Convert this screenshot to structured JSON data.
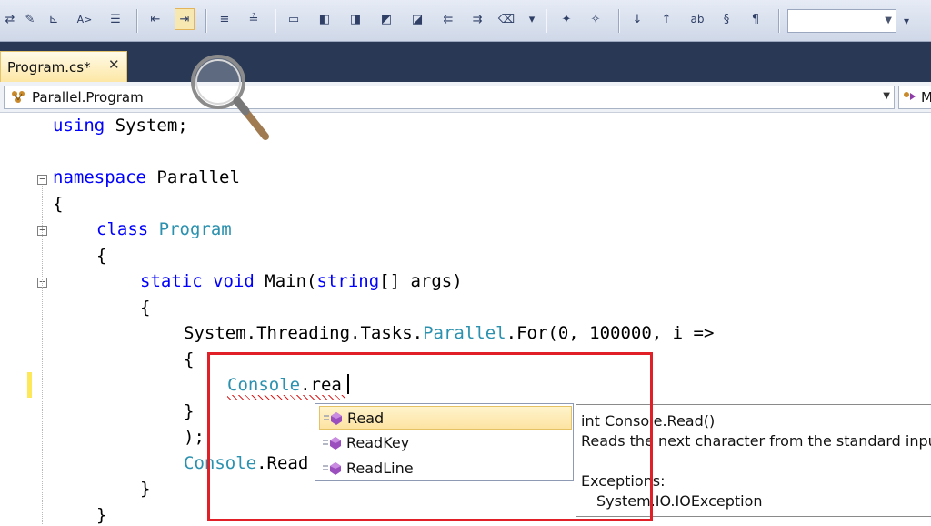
{
  "window": {
    "tab": {
      "label": "Program.cs*",
      "close_glyph": "✕"
    }
  },
  "toolbar": {
    "buttons": [
      {
        "icon": "refactor-icon"
      },
      {
        "icon": "rename-icon"
      },
      {
        "icon": "font-icon",
        "text": "A>"
      },
      {
        "icon": "outline-icon"
      },
      {
        "icon": "decrease-indent-icon"
      },
      {
        "icon": "increase-indent-icon"
      },
      {
        "icon": "comment-icon"
      },
      {
        "icon": "uncomment-icon"
      },
      {
        "icon": "bookmark-icon"
      },
      {
        "icon": "prev-bookmark-icon"
      },
      {
        "icon": "next-bookmark-icon"
      },
      {
        "icon": "prev-folder-bookmark-icon"
      },
      {
        "icon": "next-folder-bookmark-icon"
      },
      {
        "icon": "prev-doc-bookmark-icon"
      },
      {
        "icon": "next-doc-bookmark-icon"
      },
      {
        "icon": "clear-bookmarks-icon"
      },
      {
        "icon": "new-item-icon"
      },
      {
        "icon": "add-item-icon"
      },
      {
        "icon": "move-down-icon"
      },
      {
        "icon": "move-up-icon"
      },
      {
        "icon": "replace-icon",
        "text": "ab"
      },
      {
        "icon": "format-icon"
      },
      {
        "icon": "format-doc-icon"
      }
    ]
  },
  "navbar": {
    "type_combo": "Parallel.Program",
    "member_combo": "M"
  },
  "code": {
    "l1": [
      "using",
      " System;"
    ],
    "l2": [
      "namespace",
      " Parallel"
    ],
    "l3": "{",
    "l4": [
      "class",
      " ",
      "Program"
    ],
    "l5": "{",
    "l6": [
      "static",
      " ",
      "void",
      " Main(",
      "string",
      "[] args)"
    ],
    "l7": "{",
    "l8": [
      "System.Threading.Tasks.",
      "Parallel",
      ".For(0, 100000, i =>"
    ],
    "l9": "{",
    "l10": [
      "Console",
      ".rea"
    ],
    "l11": "}",
    "l12": ");",
    "l13": [
      "Console",
      ".Read"
    ],
    "l14": "}",
    "l15": "}"
  },
  "intellisense": {
    "items": [
      {
        "label": "Read",
        "selected": true
      },
      {
        "label": "ReadKey",
        "selected": false
      },
      {
        "label": "ReadLine",
        "selected": false
      }
    ]
  },
  "tooltip": {
    "signature": "int Console.Read()",
    "description": "Reads the next character from the standard input",
    "exceptions_label": "Exceptions:",
    "exception": "System.IO.IOException"
  },
  "colors": {
    "keyword": "#0000ff",
    "type": "#2b91af",
    "highlight_box": "#e01f26",
    "tab_bg": "#fde7a5",
    "tabstrip_bg": "#293955"
  }
}
